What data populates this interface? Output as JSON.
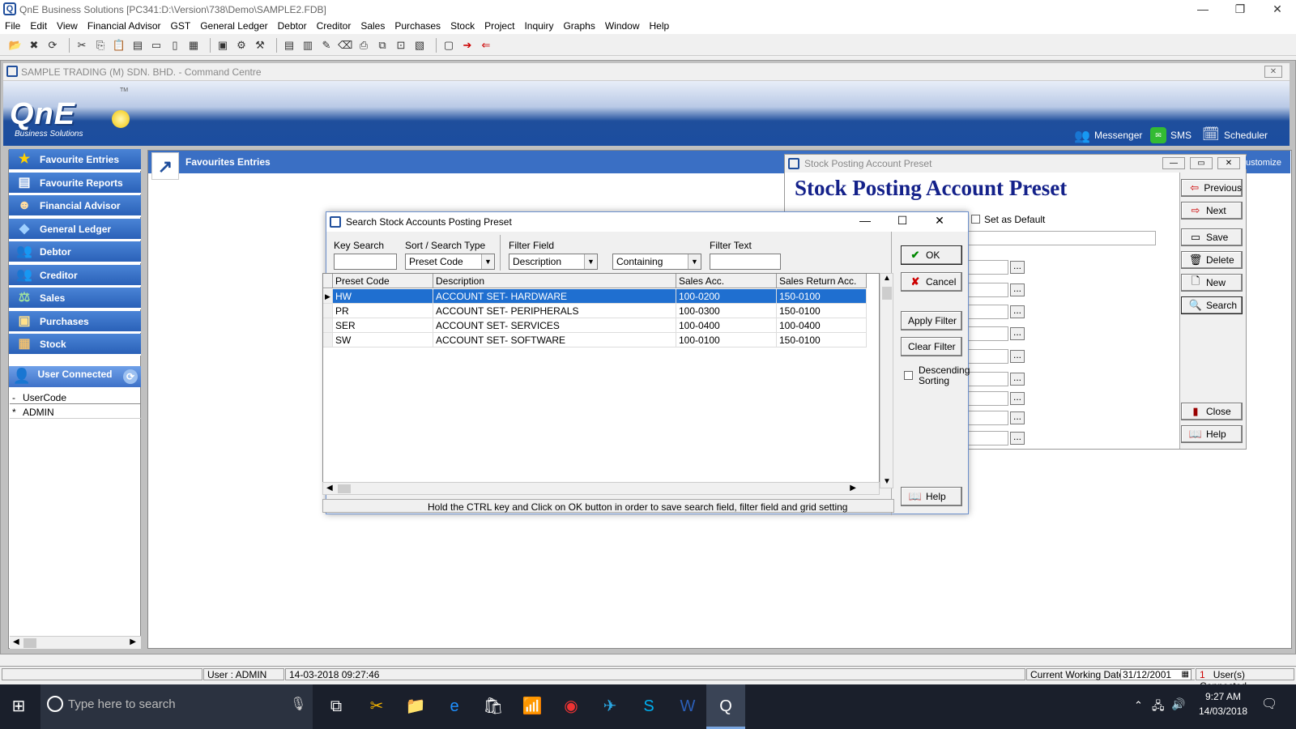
{
  "app": {
    "title": "QnE Business Solutions [PC341:D:\\Version\\738\\Demo\\SAMPLE2.FDB]",
    "controls": {
      "minimize": "—",
      "restore": "❐",
      "close": "✕"
    }
  },
  "menu": [
    "File",
    "Edit",
    "View",
    "Financial Advisor",
    "GST",
    "General Ledger",
    "Debtor",
    "Creditor",
    "Sales",
    "Purchases",
    "Stock",
    "Project",
    "Inquiry",
    "Graphs",
    "Window",
    "Help"
  ],
  "command_centre": {
    "title": "SAMPLE TRADING (M) SDN. BHD. - Command Centre",
    "logo": "QnE",
    "logo_sub": "Business Solutions",
    "logo_tm": "TM",
    "links": {
      "messenger": "Messenger",
      "sms": "SMS",
      "scheduler": "Scheduler",
      "customize": "ustomize"
    }
  },
  "sidebar": {
    "items": [
      {
        "label": "Favourite Entries",
        "icon": "star-icon"
      },
      {
        "label": "Favourite Reports",
        "icon": "report-icon"
      },
      {
        "label": "Financial Advisor",
        "icon": "advisor-icon"
      },
      {
        "label": "General Ledger",
        "icon": "ledger-icon"
      },
      {
        "label": "Debtor",
        "icon": "people-icon"
      },
      {
        "label": "Creditor",
        "icon": "people-icon"
      },
      {
        "label": "Sales",
        "icon": "sales-icon"
      },
      {
        "label": "Purchases",
        "icon": "purchases-icon"
      },
      {
        "label": "Stock",
        "icon": "stock-icon"
      }
    ],
    "user_connected": {
      "title": "User Connected",
      "col_header": "UserCode",
      "row_marker": "*",
      "header_marker": "-",
      "user": "ADMIN"
    }
  },
  "favourites": {
    "title": "Favourites Entries"
  },
  "preset_window": {
    "title": "Stock Posting Account Preset",
    "heading": "Stock Posting Account Preset",
    "set_as_default": "Set as Default",
    "dots": "...",
    "buttons": {
      "previous": "Previous",
      "next": "Next",
      "save": "Save",
      "delete": "Delete",
      "new": "New",
      "search": "Search",
      "close": "Close",
      "help": "Help"
    }
  },
  "search_dialog": {
    "title": "Search Stock Accounts Posting Preset",
    "key_search_label": "Key Search",
    "key_search_value": "",
    "sort_label": "Sort / Search Type",
    "sort_value": "Preset Code",
    "filter_field_label": "Filter Field",
    "filter_field_value": "Description",
    "filter_op_value": "Containing",
    "filter_text_label": "Filter Text",
    "filter_text_value": "",
    "columns": [
      "Preset Code",
      "Description",
      "Sales Acc.",
      "Sales Return Acc."
    ],
    "rows": [
      {
        "code": "HW",
        "desc": "ACCOUNT SET- HARDWARE",
        "sales": "100-0200",
        "ret": "150-0100"
      },
      {
        "code": "PR",
        "desc": "ACCOUNT SET- PERIPHERALS",
        "sales": "100-0300",
        "ret": "150-0100"
      },
      {
        "code": "SER",
        "desc": "ACCOUNT SET- SERVICES",
        "sales": "100-0400",
        "ret": "100-0400"
      },
      {
        "code": "SW",
        "desc": "ACCOUNT SET- SOFTWARE",
        "sales": "100-0100",
        "ret": "150-0100"
      }
    ],
    "hint": "Hold the CTRL key and Click on OK button in order to save search field, filter field and grid setting",
    "buttons": {
      "ok": "OK",
      "cancel": "Cancel",
      "apply_filter": "Apply Filter",
      "clear_filter": "Clear Filter",
      "help": "Help"
    },
    "descending_sorting": "Descending Sorting"
  },
  "status": {
    "user": "User : ADMIN",
    "datetime": "14-03-2018 09:27:46",
    "working_date_label": "Current Working Date :",
    "working_date": "31/12/2001",
    "users_count": "1",
    "users_connected": "User(s) Connected."
  },
  "taskbar": {
    "search_placeholder": "Type here to search",
    "time": "9:27 AM",
    "date": "14/03/2018"
  }
}
